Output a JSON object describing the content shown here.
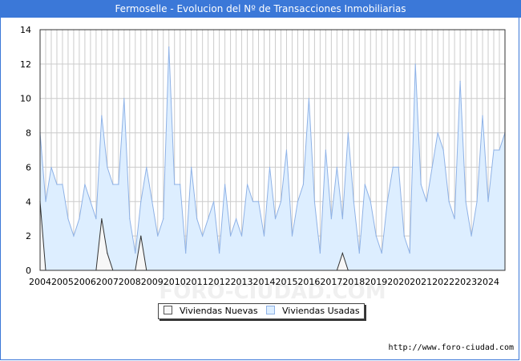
{
  "title": "Fermoselle - Evolucion del Nº de Transacciones Inmobiliarias",
  "footer_url": "http://www.foro-ciudad.com",
  "watermark": "FORO-CIUDAD.COM",
  "colors": {
    "title_bg": "#3b78d8",
    "usadas_fill": "#ddeeff",
    "usadas_line": "#8fb2e6",
    "nuevas_fill": "#f7f7f7",
    "nuevas_line": "#333333",
    "grid": "#cccccc"
  },
  "chart_data": {
    "type": "area",
    "x_tick_labels": [
      "2004",
      "2005",
      "2006",
      "2007",
      "2008",
      "2009",
      "2010",
      "2011",
      "2012",
      "2013",
      "2014",
      "2015",
      "2016",
      "2017",
      "2018",
      "2019",
      "2020",
      "2021",
      "2022",
      "2023",
      "2024"
    ],
    "x_start": 2004,
    "x_end": 2024.75,
    "ylim": [
      0,
      14
    ],
    "yticks": [
      0,
      2,
      4,
      6,
      8,
      10,
      12,
      14
    ],
    "grid": true,
    "legend_position": "bottom-center",
    "series": [
      {
        "name": "Viviendas Nuevas",
        "color": "#333333",
        "fill": "#f7f7f7",
        "x": [
          2004.0,
          2004.25,
          2004.5,
          2004.75,
          2005.0,
          2005.25,
          2005.5,
          2005.75,
          2006.0,
          2006.25,
          2006.5,
          2006.75,
          2007.0,
          2007.25,
          2007.5,
          2007.75,
          2008.0,
          2008.25,
          2008.5,
          2008.75,
          2009.0,
          2009.25,
          2009.5,
          2009.75,
          2010.0,
          2010.25,
          2010.5,
          2010.75,
          2011.0,
          2011.25,
          2011.5,
          2011.75,
          2012.0,
          2012.25,
          2012.5,
          2012.75,
          2013.0,
          2013.25,
          2013.5,
          2013.75,
          2014.0,
          2014.25,
          2014.5,
          2014.75,
          2015.0,
          2015.25,
          2015.5,
          2015.75,
          2016.0,
          2016.25,
          2016.5,
          2016.75,
          2017.0,
          2017.25,
          2017.5,
          2017.75,
          2018.0,
          2018.25,
          2018.5,
          2018.75,
          2019.0,
          2019.25,
          2019.5,
          2019.75,
          2020.0,
          2020.25,
          2020.5,
          2020.75,
          2021.0,
          2021.25,
          2021.5,
          2021.75,
          2022.0,
          2022.25,
          2022.5,
          2022.75,
          2023.0,
          2023.25,
          2023.5,
          2023.75,
          2024.0,
          2024.25,
          2024.5,
          2024.75
        ],
        "values": [
          4,
          0,
          0,
          0,
          0,
          0,
          0,
          0,
          0,
          0,
          0,
          3,
          1,
          0,
          0,
          0,
          0,
          0,
          2,
          0,
          0,
          0,
          0,
          0,
          0,
          0,
          0,
          0,
          0,
          0,
          0,
          0,
          0,
          0,
          0,
          0,
          0,
          0,
          0,
          0,
          0,
          0,
          0,
          0,
          0,
          0,
          0,
          0,
          0,
          0,
          0,
          0,
          0,
          0,
          1,
          0,
          0,
          0,
          0,
          0,
          0,
          0,
          0,
          0,
          0,
          0,
          0,
          0,
          0,
          0,
          0,
          0,
          0,
          0,
          0,
          0,
          0,
          0,
          0,
          0,
          0,
          0,
          0,
          0
        ]
      },
      {
        "name": "Viviendas Usadas",
        "color": "#8fb2e6",
        "fill": "#ddeeff",
        "x": [
          2004.0,
          2004.25,
          2004.5,
          2004.75,
          2005.0,
          2005.25,
          2005.5,
          2005.75,
          2006.0,
          2006.25,
          2006.5,
          2006.75,
          2007.0,
          2007.25,
          2007.5,
          2007.75,
          2008.0,
          2008.25,
          2008.5,
          2008.75,
          2009.0,
          2009.25,
          2009.5,
          2009.75,
          2010.0,
          2010.25,
          2010.5,
          2010.75,
          2011.0,
          2011.25,
          2011.5,
          2011.75,
          2012.0,
          2012.25,
          2012.5,
          2012.75,
          2013.0,
          2013.25,
          2013.5,
          2013.75,
          2014.0,
          2014.25,
          2014.5,
          2014.75,
          2015.0,
          2015.25,
          2015.5,
          2015.75,
          2016.0,
          2016.25,
          2016.5,
          2016.75,
          2017.0,
          2017.25,
          2017.5,
          2017.75,
          2018.0,
          2018.25,
          2018.5,
          2018.75,
          2019.0,
          2019.25,
          2019.5,
          2019.75,
          2020.0,
          2020.25,
          2020.5,
          2020.75,
          2021.0,
          2021.25,
          2021.5,
          2021.75,
          2022.0,
          2022.25,
          2022.5,
          2022.75,
          2023.0,
          2023.25,
          2023.5,
          2023.75,
          2024.0,
          2024.25,
          2024.5,
          2024.75
        ],
        "values": [
          8,
          4,
          6,
          5,
          5,
          3,
          2,
          3,
          5,
          4,
          3,
          9,
          6,
          5,
          5,
          10,
          3,
          1,
          4,
          6,
          4,
          2,
          3,
          13,
          5,
          5,
          1,
          6,
          3,
          2,
          3,
          4,
          1,
          5,
          2,
          3,
          2,
          5,
          4,
          4,
          2,
          6,
          3,
          4,
          7,
          2,
          4,
          5,
          10,
          4,
          1,
          7,
          3,
          6,
          3,
          8,
          4,
          1,
          5,
          4,
          2,
          1,
          4,
          6,
          6,
          2,
          1,
          12,
          5,
          4,
          6,
          8,
          7,
          4,
          3,
          11,
          4,
          2,
          4,
          9,
          4,
          7,
          7,
          8
        ]
      }
    ]
  }
}
